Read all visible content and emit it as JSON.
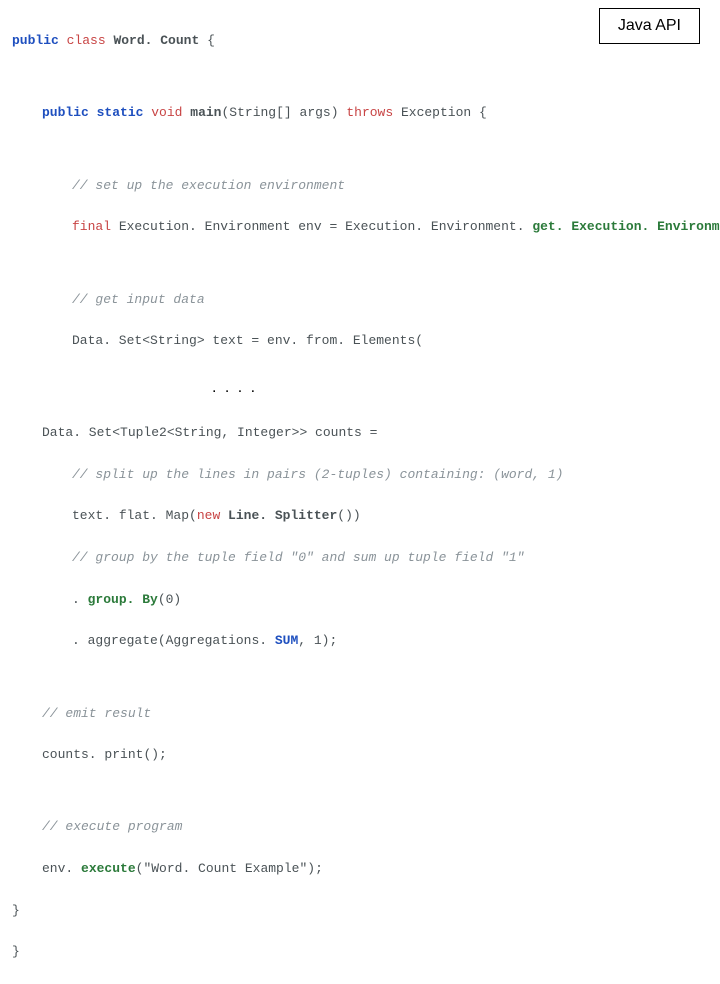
{
  "label": "Java API",
  "code": {
    "l1_public": "public",
    "l1_class": "class",
    "l1_classname": "Word. Count",
    "l1_brace": " {",
    "l2_public": "public",
    "l2_static": "static",
    "l2_void": "void",
    "l2_main": "main",
    "l2_params": "(String[] args)",
    "l2_throws": "throws",
    "l2_exc": "Exception",
    "l2_brace": " {",
    "c1": "// set up the execution environment",
    "l3_final": "final",
    "l3_type": "Execution. Environment env",
    "l3_eq": " = Execution. Environment. ",
    "l3_method": "get. Execution. Environment",
    "l3_end": "();",
    "c2": "// get input data",
    "l4_a": "Data. Set<String> text = env. ",
    "l4_method": "from. Elements",
    "l4_end": "(",
    "ellipsis": ". . . .",
    "l5_a": "Data. Set<Tuple2<String, Integer>> counts =",
    "c3": "// split up the lines in pairs (2-tuples) containing: (word, 1)",
    "l6_a": "text. ",
    "l6_m": "flat. Map",
    "l6_b": "(",
    "l6_new": "new",
    "l6_cls": " Line. Splitter",
    "l6_end": "())",
    "c4": "// group by the tuple field \"0\" and sum up tuple field \"1\"",
    "l7_a": ". ",
    "l7_m": "group. By",
    "l7_end": "(0)",
    "l8_a": ". ",
    "l8_m": "aggregate",
    "l8_b": "(Aggregations. ",
    "l8_sum": "SUM",
    "l8_end": ", 1);",
    "c5": "// emit result",
    "l9_a": "counts. ",
    "l9_m": "print",
    "l9_end": "();",
    "c6": "// execute program",
    "l10_a": "env. ",
    "l10_m": "execute",
    "l10_b": "(",
    "l10_str": "\"Word. Count Example\"",
    "l10_end": ");",
    "brace1": "}",
    "brace2": "}"
  }
}
